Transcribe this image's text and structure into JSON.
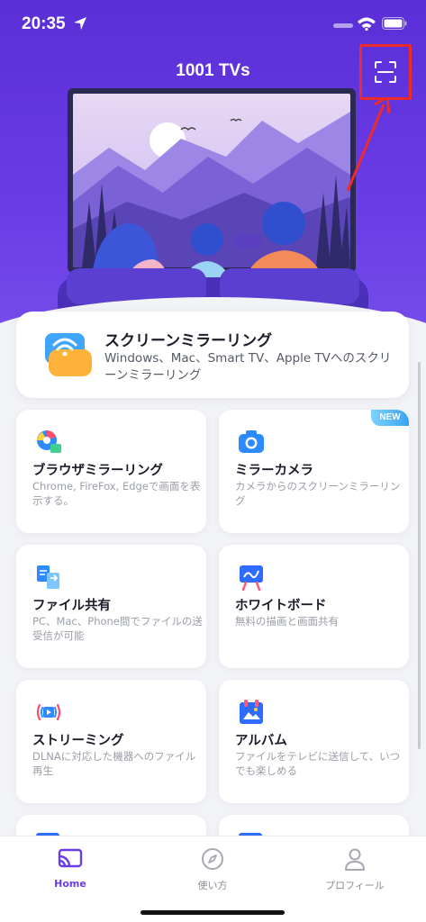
{
  "status": {
    "time": "20:35"
  },
  "header": {
    "title": "1001 TVs",
    "scan_icon": "scan-icon"
  },
  "mirror": {
    "title": "スクリーンミラーリング",
    "description": "Windows、Mac、Smart TV、Apple TVへのスクリーンミラーリング"
  },
  "features": [
    {
      "title": "ブラウザミラーリング",
      "description": "Chrome, FireFox, Edgeで画面を表示する。",
      "icon": "browser-icon"
    },
    {
      "title": "ミラーカメラ",
      "description": "カメラからのスクリーンミラーリング",
      "icon": "camera-icon",
      "badge": "NEW"
    },
    {
      "title": "ファイル共有",
      "description": "PC、Mac、Phone間でファイルの送受信が可能",
      "icon": "file-share-icon"
    },
    {
      "title": "ホワイトボード",
      "description": "無料の描画と画面共有",
      "icon": "whiteboard-icon"
    },
    {
      "title": "ストリーミング",
      "description": "DLNAに対応した機器へのファイル再生",
      "icon": "streaming-icon"
    },
    {
      "title": "アルバム",
      "description": "ファイルをテレビに送信して、いつでも楽しめる",
      "icon": "album-icon"
    }
  ],
  "tabs": [
    {
      "label": "Home",
      "icon": "cast-icon",
      "active": true
    },
    {
      "label": "使い方",
      "icon": "compass-icon",
      "active": false
    },
    {
      "label": "プロフィール",
      "icon": "profile-icon",
      "active": false
    }
  ],
  "colors": {
    "accent": "#6a3ce6",
    "highlight": "#ee2b2b",
    "badge": "#3aa3f0"
  }
}
